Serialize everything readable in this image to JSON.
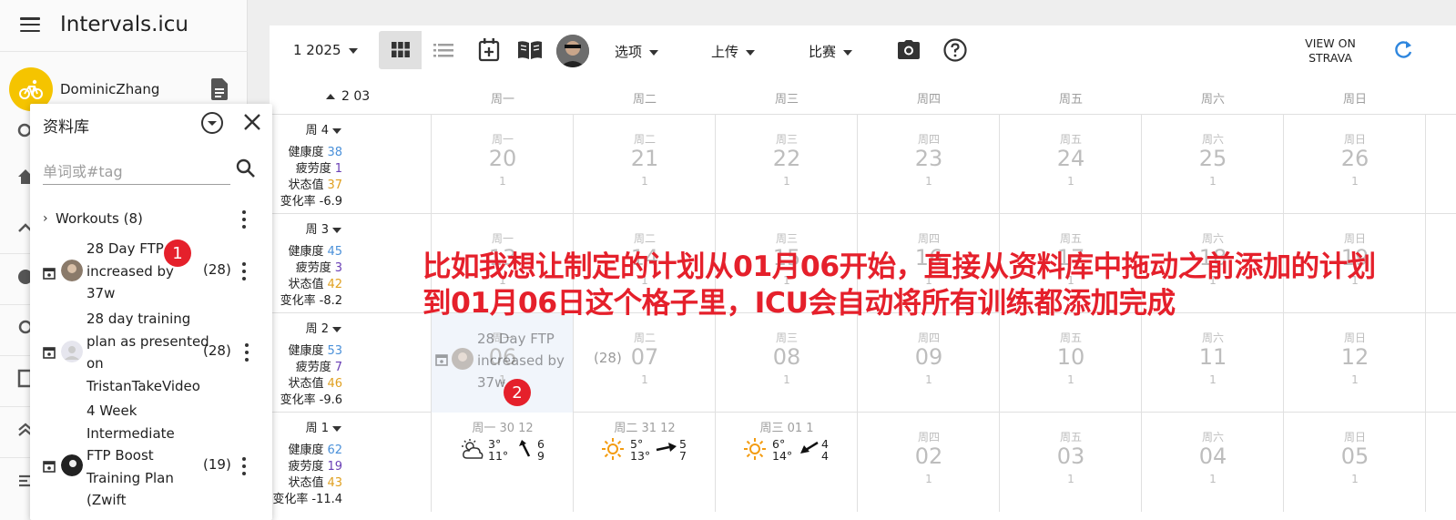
{
  "app": {
    "title": "Intervals.icu",
    "user_name": "DominicZhang"
  },
  "library": {
    "title": "资料库",
    "search_placeholder": "单词或#tag",
    "folder_label": "Workouts (8)",
    "items": [
      {
        "name": "28 Day FTP increased by 37w",
        "count": "(28)"
      },
      {
        "name": "28 day training plan as presented on TristanTakeVideo",
        "count": "(28)"
      },
      {
        "name": "4 Week Intermediate FTP Boost Training Plan (Zwift",
        "count": "(19)"
      }
    ]
  },
  "badges": {
    "one": "1",
    "two": "2"
  },
  "toolbar": {
    "month": "1 2025",
    "options": "选项",
    "upload": "上传",
    "race": "比赛",
    "strava": "VIEW ON STRAVA"
  },
  "calendar": {
    "header_month": "2 03",
    "weekday_headers": [
      "周一",
      "周二",
      "周三",
      "周四",
      "周五",
      "周六",
      "周日"
    ],
    "stat_labels": {
      "fitness": "健康度",
      "fatigue": "疲劳度",
      "form": "状态值",
      "ramp": "变化率"
    },
    "weeks": [
      {
        "title": "周 4",
        "fitness": "38",
        "fatigue": "1",
        "form": "37",
        "ramp": "-6.9",
        "days": [
          {
            "label": "周一",
            "num": "20",
            "sub": "1"
          },
          {
            "label": "周二",
            "num": "21",
            "sub": "1"
          },
          {
            "label": "周三",
            "num": "22",
            "sub": "1"
          },
          {
            "label": "周四",
            "num": "23",
            "sub": "1"
          },
          {
            "label": "周五",
            "num": "24",
            "sub": "1"
          },
          {
            "label": "周六",
            "num": "25",
            "sub": "1"
          },
          {
            "label": "周日",
            "num": "26",
            "sub": "1"
          }
        ]
      },
      {
        "title": "周 3",
        "fitness": "45",
        "fatigue": "3",
        "form": "42",
        "ramp": "-8.2",
        "days": [
          {
            "label": "周一",
            "num": "13",
            "sub": "1"
          },
          {
            "label": "周二",
            "num": "14",
            "sub": "1"
          },
          {
            "label": "周三",
            "num": "15",
            "sub": "1"
          },
          {
            "label": "周四",
            "num": "16",
            "sub": "1"
          },
          {
            "label": "周五",
            "num": "17",
            "sub": "1"
          },
          {
            "label": "周六",
            "num": "18",
            "sub": "1"
          },
          {
            "label": "周日",
            "num": "19",
            "sub": "1"
          }
        ]
      },
      {
        "title": "周 2",
        "fitness": "53",
        "fatigue": "7",
        "form": "46",
        "ramp": "-9.6",
        "days": [
          {
            "label": "周一",
            "num": "06",
            "sub": "1"
          },
          {
            "label": "周二",
            "num": "07",
            "sub": "1"
          },
          {
            "label": "周三",
            "num": "08",
            "sub": "1"
          },
          {
            "label": "周四",
            "num": "09",
            "sub": "1"
          },
          {
            "label": "周五",
            "num": "10",
            "sub": "1"
          },
          {
            "label": "周六",
            "num": "11",
            "sub": "1"
          },
          {
            "label": "周日",
            "num": "12",
            "sub": "1"
          }
        ]
      },
      {
        "title": "周 1",
        "fitness": "62",
        "fatigue": "19",
        "form": "43",
        "ramp": "-11.4",
        "weather_days": [
          {
            "head": "周一 30 12",
            "lo": "3°",
            "hi": "11°",
            "w1": "6",
            "w2": "9"
          },
          {
            "head": "周二 31 12",
            "lo": "5°",
            "hi": "13°",
            "w1": "5",
            "w2": "7"
          },
          {
            "head": "周三 01 1",
            "lo": "6°",
            "hi": "14°",
            "w1": "4",
            "w2": "4"
          }
        ],
        "days": [
          {
            "label": "周四",
            "num": "02",
            "sub": "1"
          },
          {
            "label": "周五",
            "num": "03",
            "sub": "1"
          },
          {
            "label": "周六",
            "num": "04",
            "sub": "1"
          },
          {
            "label": "周日",
            "num": "05",
            "sub": "1"
          }
        ]
      }
    ]
  },
  "drag_ghost": {
    "name": "28 Day FTP increased by 37w",
    "count": "(28)"
  },
  "annotation": {
    "line1": "比如我想让制定的计划从01月06开始，直接从资料库中拖动之前添加的计划",
    "line2": "到01月06日这个格子里，ICU会自动将所有训练都添加完成"
  },
  "colors": {
    "fitness": "#4a90d9",
    "fatigue": "#6a3fb5",
    "form": "#e0a020",
    "accent": "#2e86de",
    "annotation": "#e5202b"
  }
}
